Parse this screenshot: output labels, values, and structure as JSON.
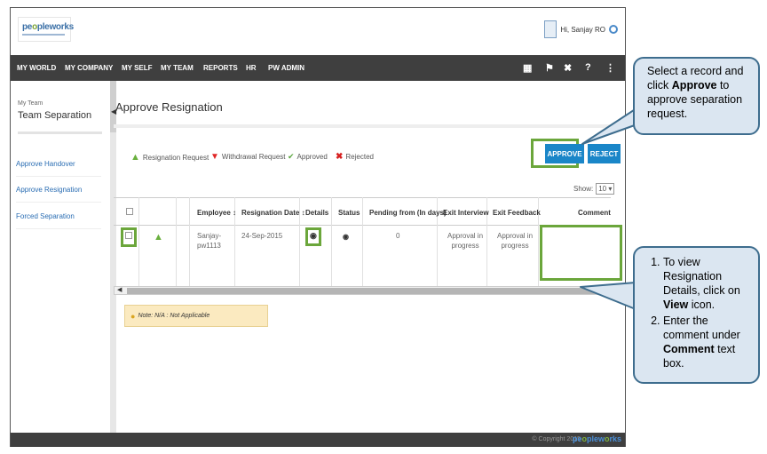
{
  "header": {
    "logo_text_a": "pe",
    "logo_text_b": "o",
    "logo_text_c": "pleworks",
    "greeting": "Hi, Sanjay RO"
  },
  "nav": {
    "items": [
      "MY WORLD",
      "MY COMPANY",
      "MY SELF",
      "MY TEAM",
      "REPORTS",
      "HR",
      "PW ADMIN"
    ],
    "icons": [
      "book-icon",
      "flag-icon",
      "tools-icon",
      "help-icon",
      "share-icon"
    ]
  },
  "sidebar": {
    "category": "My Team",
    "title": "Team Separation",
    "links": [
      "Approve Handover",
      "Approve Resignation",
      "Forced Separation"
    ]
  },
  "main": {
    "title": "Approve Resignation",
    "legend": [
      "Resignation Request",
      "Withdrawal Request",
      "Approved",
      "Rejected"
    ],
    "approve_label": "APPROVE",
    "reject_label": "REJECT",
    "show_label": "Show:",
    "show_value": "10",
    "columns": [
      "Employee",
      "Resignation Date",
      "Details",
      "Status",
      "Pending from (In days)",
      "Exit Interview",
      "Exit Feedback",
      "Comment"
    ],
    "sort_mark": "↕",
    "row": {
      "employee_line1": "Sanjay-",
      "employee_line2": "pw1113",
      "date": "24-Sep-2015",
      "pending": "0",
      "exit_interview_1": "Approval in",
      "exit_interview_2": "progress",
      "exit_feedback_1": "Approval in",
      "exit_feedback_2": "progress"
    },
    "note": "Note: N/A : Not Applicable"
  },
  "footer": {
    "copyright": "© Copyright 2015",
    "logo_a": "pe",
    "logo_b": "o",
    "logo_c": "plew",
    "logo_d": "o",
    "logo_e": "rks"
  },
  "callouts": {
    "first_pre": "Select a record and click ",
    "first_bold": "Approve",
    "first_post": " to approve separation request.",
    "step1_pre": "To view Resignation Details, click on ",
    "step1_bold": "View",
    "step1_post": " icon.",
    "step2_pre": "Enter the comment under ",
    "step2_bold": "Comment",
    "step2_post": " text box."
  },
  "colors": {
    "nav_bg": "#3f3f3f",
    "button_blue": "#1a86c8",
    "highlight_green": "#6ba63b",
    "callout_fill": "#dbe6f1",
    "callout_border": "#3e6d8e"
  }
}
